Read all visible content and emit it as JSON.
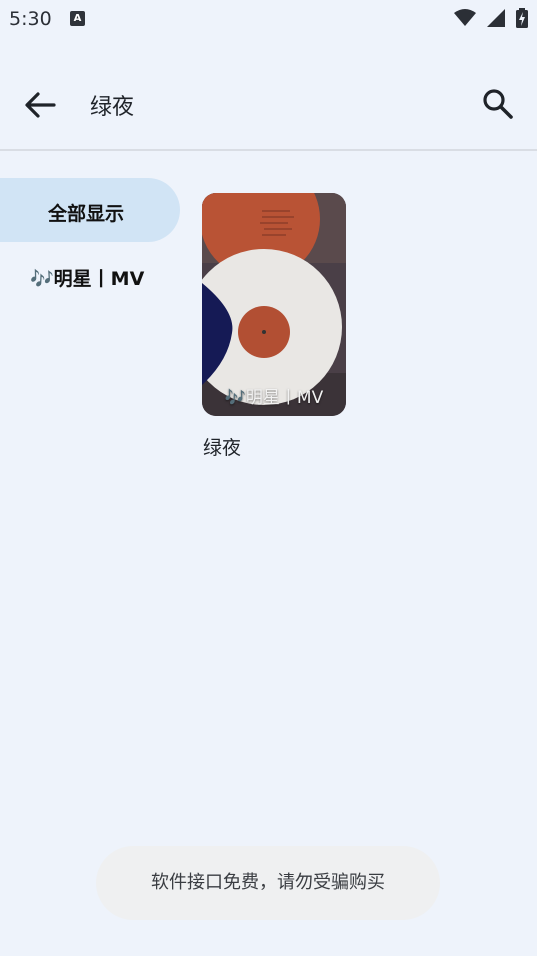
{
  "status_bar": {
    "time": "5:30",
    "notification_icon": "A",
    "icons": [
      "wifi-icon",
      "cell-signal-icon",
      "battery-charging-icon"
    ]
  },
  "app_bar": {
    "title": "绿夜",
    "back_icon": "arrow-left-icon",
    "search_icon": "search-icon"
  },
  "categories": [
    {
      "label": "全部显示",
      "selected": true
    },
    {
      "label": "🎶明星丨MV",
      "selected": false
    }
  ],
  "items": [
    {
      "title": "绿夜",
      "overlay_label": "🎶明星丨MV"
    }
  ],
  "toast": {
    "message": "软件接口免费，请勿受骗购买"
  },
  "colors": {
    "background": "#eef3fb",
    "selected_category": "#d1e4f5",
    "toast_background": "#eff0f1"
  }
}
